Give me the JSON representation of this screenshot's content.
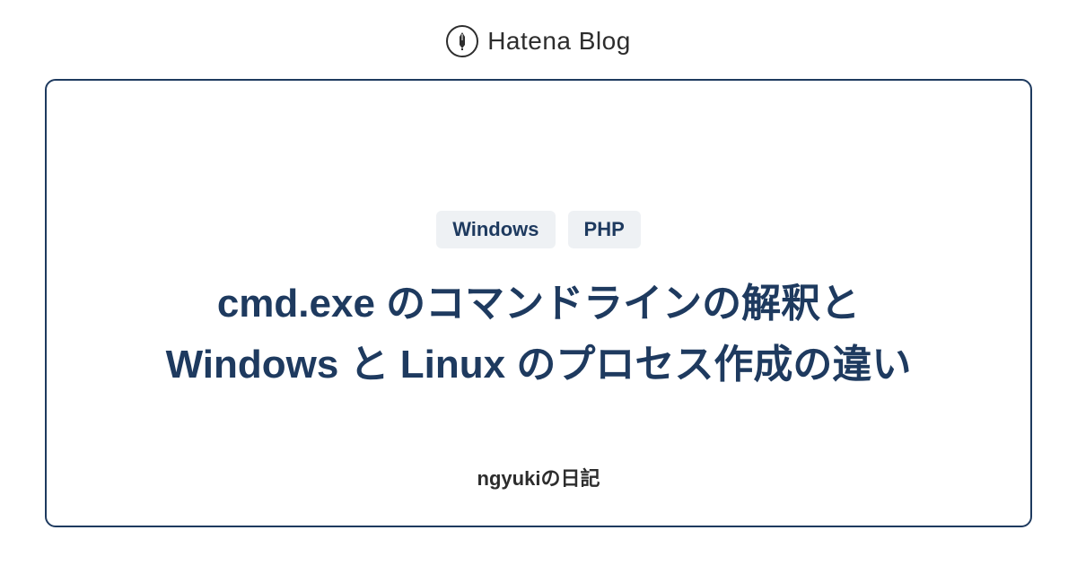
{
  "header": {
    "brand": "Hatena Blog"
  },
  "card": {
    "tags": [
      "Windows",
      "PHP"
    ],
    "title": "cmd.exe のコマンドラインの解釈と Windows と Linux のプロセス作成の違い",
    "author": "ngyukiの日記"
  }
}
